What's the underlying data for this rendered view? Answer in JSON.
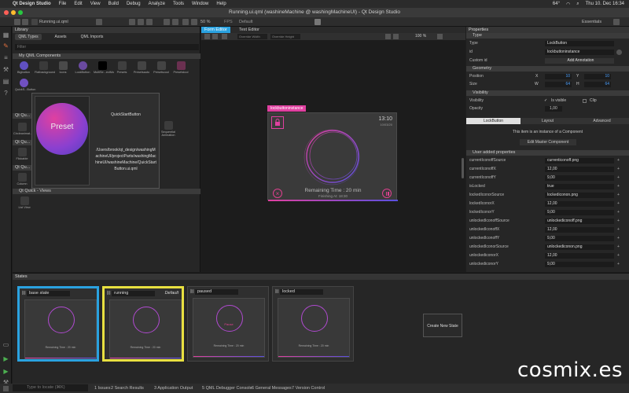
{
  "menubar": {
    "app": "Qt Design Studio",
    "items": [
      "File",
      "Edit",
      "View",
      "Build",
      "Debug",
      "Analyze",
      "Tools",
      "Window",
      "Help"
    ],
    "clock": "Thu 10. Dec 16:34",
    "temp": "64°"
  },
  "titlebar": {
    "title": "Running.ui.qml (washineMachine @ washingMachineUI) - Qt Design Studio"
  },
  "toolbar": {
    "file": "Running.ui.qml",
    "zoom": "50 %",
    "fps": "FPS",
    "preset": "Default",
    "workspace": "Essentials"
  },
  "library": {
    "title": "Library",
    "tabs": [
      "QML Types",
      "Assets",
      "QML Imports"
    ],
    "filter_placeholder": "Filter",
    "sections": [
      "My QML Components",
      "Qt Qu...",
      "Qt Qu...",
      "Qt Qu...",
      "Qt Quick - Views"
    ],
    "components": [
      "Bigbutton",
      "Flatbackground",
      "Icons",
      "LockButton",
      "MultiSe...ectMo",
      "Presets",
      "Presetsauto",
      "Presetscool",
      "Presetstool",
      "QuickS...Button",
      "Remai...",
      "StartBu...",
      "..."
    ],
    "more": [
      "Circleanimat...",
      "Flickable",
      "Column"
    ],
    "views": [
      "List View"
    ],
    "popup": {
      "preset_label": "Preset",
      "name": "QuickStartButton",
      "path": "/Users/brook/qt_design/washingMachineUI/projectParts/washingMachineUI/washineMachine/QuickStartButton.ui.qml",
      "seq_label": "Sequential Animation"
    }
  },
  "editor": {
    "tabs": [
      "Form Editor",
      "Text Editor"
    ],
    "override_w": "Override Width",
    "override_h": "Override Height",
    "zoom": "100 %",
    "selection_label": "lockbuttoninstance",
    "clock_time": "13:10",
    "clock_date": "10/03/20",
    "remaining_text": "Remaining Time : 20 min",
    "finishing_text": "Finishing At: 18:30"
  },
  "properties": {
    "title": "Properties",
    "sections": [
      "Type",
      "Geometry",
      "Visibility",
      "User added properties"
    ],
    "type_label": "Type",
    "type_value": "LockButton",
    "id_label": "id",
    "id_value": "lockbuttoninstance",
    "custom_id_label": "Custom id",
    "add_annotation": "Add Annotation",
    "position_label": "Position",
    "x_label": "X",
    "x_value": "10",
    "y_label": "Y",
    "y_value": "10",
    "size_label": "Size",
    "w_label": "W",
    "w_value": "64",
    "h_label": "H",
    "h_value": "64",
    "visibility_label": "Visibility",
    "is_visible": "Is visible",
    "clip": "Clip",
    "opacity_label": "Opacity",
    "opacity_value": "1,00",
    "subtabs": [
      "LockButton",
      "Layout",
      "Advanced"
    ],
    "instance_note": "This item is an instance of a Component",
    "edit_master": "Edit Master Component",
    "user_props": [
      {
        "name": "currentIconoffSource",
        "value": "currenticonoff.png"
      },
      {
        "name": "currentIconoffX",
        "value": "12,00"
      },
      {
        "name": "currentIconoffY",
        "value": "9,00"
      },
      {
        "name": "isLocked",
        "value": "true"
      },
      {
        "name": "lockedIconorSource",
        "value": "lockediconon.png"
      },
      {
        "name": "lockedIconorX",
        "value": "12,00"
      },
      {
        "name": "lockedIconorY",
        "value": "9,00"
      },
      {
        "name": "unlockedIconoffSource",
        "value": "unlockediconoff.png"
      },
      {
        "name": "unlockedIconoffX",
        "value": "12,00"
      },
      {
        "name": "unlockedIconoffY",
        "value": "9,00"
      },
      {
        "name": "unlockedIconorSource",
        "value": "unlockediconon.png"
      },
      {
        "name": "unlockediconorX",
        "value": "12,00"
      },
      {
        "name": "unlockediconorY",
        "value": "9,00"
      }
    ]
  },
  "states": {
    "title": "States",
    "items": [
      {
        "name": "base state",
        "default": ""
      },
      {
        "name": "running",
        "default": "Default"
      },
      {
        "name": "paused",
        "default": ""
      },
      {
        "name": "locked",
        "default": ""
      }
    ],
    "create_label": "Create New State",
    "thumb_remaining": "Remaining Time : 20 min",
    "thumb_pause": "Pause"
  },
  "bottombar": {
    "locate_placeholder": "Type to locate (⌘K)",
    "items": [
      "1 Issues",
      "2 Search Results",
      "3 Application Output",
      "5 QML Debugger Console",
      "6 General Messages",
      "7 Version Control"
    ]
  },
  "watermark": "cosmix.es",
  "colors": {
    "accent_pink": "#e040a0",
    "accent_purple": "#6a50e0",
    "states_selected": "#2aa2e0",
    "states_default": "#e8e040"
  }
}
